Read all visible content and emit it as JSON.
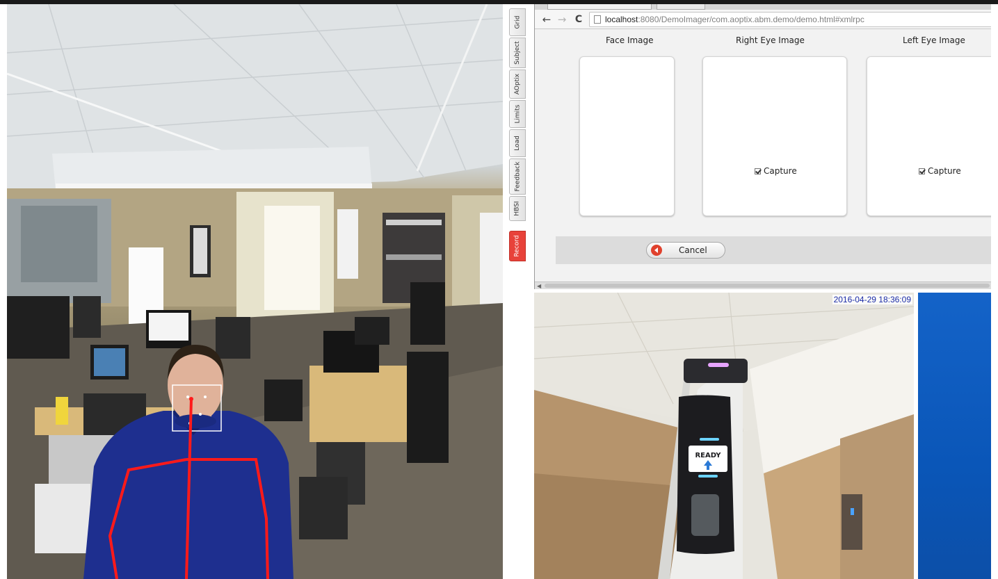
{
  "left_panel": {
    "name": "Subject camera feed"
  },
  "side_tabs": [
    "Grid",
    "Subject",
    "AOptix",
    "Limits",
    "Load",
    "Feedback",
    "HBSI",
    "Record"
  ],
  "browser": {
    "url_host": "localhost",
    "url_rest": ":8080/DemoImager/com.aoptix.abm.demo/demo.html#xmlrpc"
  },
  "demo_page": {
    "columns": [
      {
        "title": "Face Image"
      },
      {
        "title": "Right Eye Image",
        "capture_label": "Capture",
        "capture_checked": true
      },
      {
        "title": "Left Eye Image",
        "capture_label": "Capture",
        "capture_checked": true
      }
    ],
    "cancel_label": "Cancel"
  },
  "device_camera": {
    "timestamp": "2016-04-29 18:36:09",
    "device_label": "READY"
  },
  "colors": {
    "record_tab": "#e8423a",
    "skeleton": "#ff1a1a",
    "cancel_icon": "#e0412d",
    "timestamp": "#1b2ba6",
    "desktop": "#0a56b8"
  }
}
